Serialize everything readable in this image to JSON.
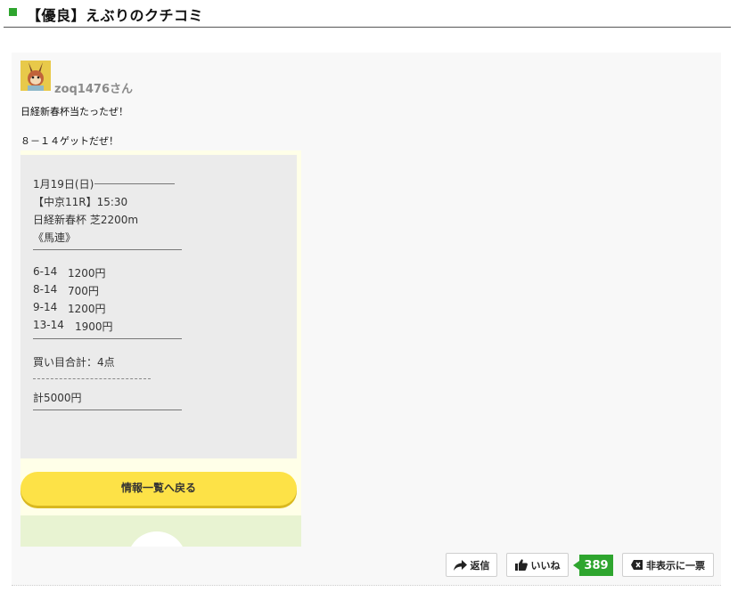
{
  "section": {
    "title": "【優良】えぶりのクチコミ"
  },
  "review": {
    "username": "zoq1476さん",
    "comment_line1": "日経新春杯当たったぜ！",
    "comment_line2": "８－１４ゲットだぜ！",
    "ticket": {
      "date": "1月19日(日)",
      "race": "【中京11R】15:30",
      "race_name": "日経新春杯 芝2200m",
      "bet_type": "《馬連》",
      "bets": [
        {
          "combo": "6-14",
          "amount": "1200円"
        },
        {
          "combo": "8-14",
          "amount": "700円"
        },
        {
          "combo": "9-14",
          "amount": "1200円"
        },
        {
          "combo": "13-14",
          "amount": "1900円"
        }
      ],
      "total_points": "買い目合計：4点",
      "total_amount": "計5000円"
    },
    "back_button": "情報一覧へ戻る"
  },
  "actions": {
    "reply": "返信",
    "like": "いいね",
    "like_count": "389",
    "hide_vote": "非表示に一票"
  },
  "colors": {
    "accent_green": "#2ea52e",
    "button_yellow": "#fde247"
  },
  "icons": [
    "reply-arrow-icon",
    "thumbs-up-icon",
    "hide-x-icon",
    "character-avatar"
  ]
}
